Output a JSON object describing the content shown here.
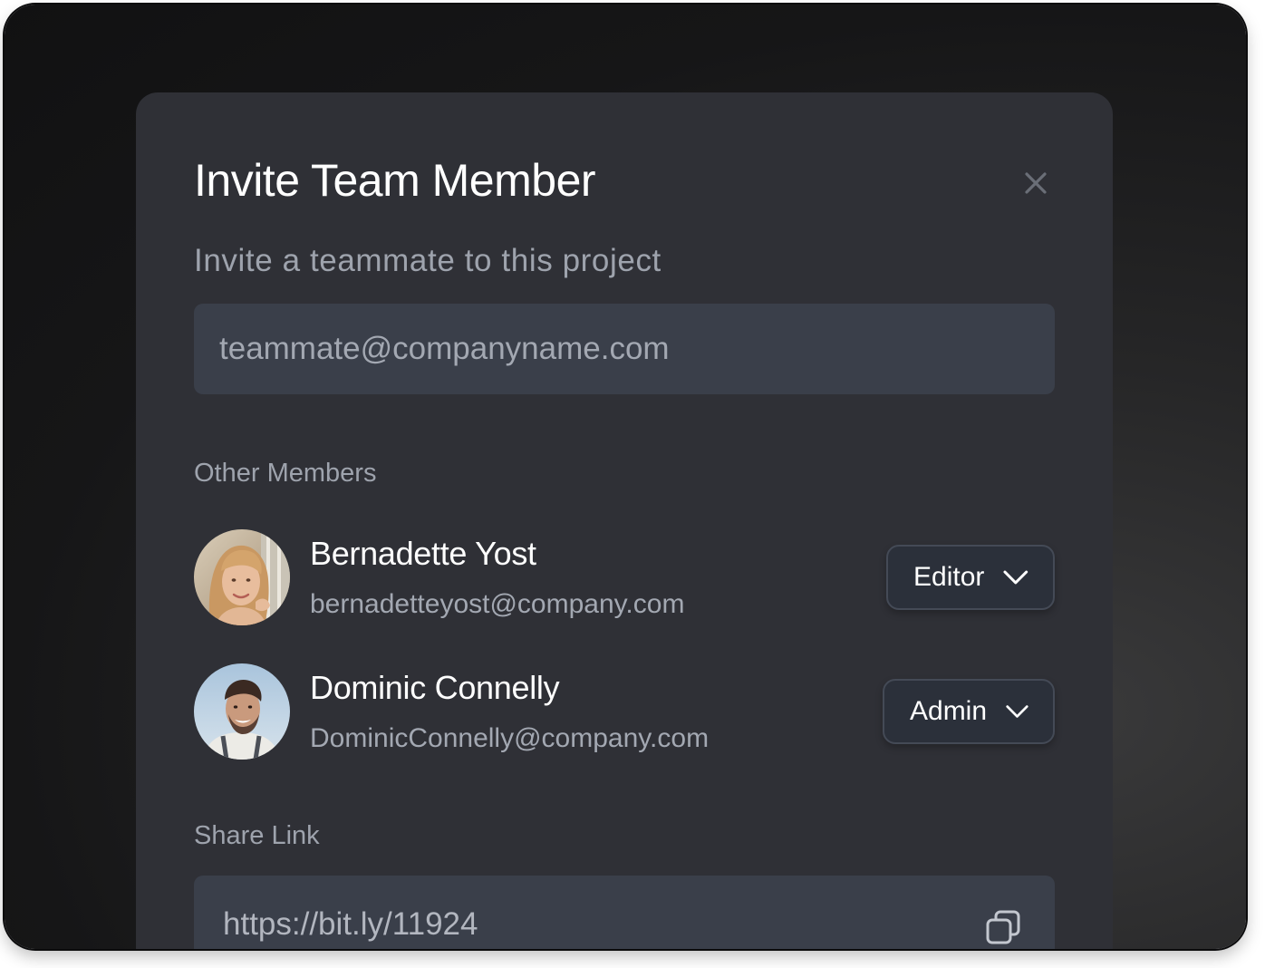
{
  "modal": {
    "title": "Invite Team Member",
    "subtitle": "Invite a teammate to this project",
    "email_placeholder": "teammate@companyname.com",
    "close_icon": "close-icon"
  },
  "members_section": {
    "label": "Other Members",
    "members": [
      {
        "name": "Bernadette Yost",
        "email": "bernadetteyost@company.com",
        "role": "Editor",
        "avatar": "avatar-photo"
      },
      {
        "name": "Dominic Connelly",
        "email": "DominicConnelly@company.com",
        "role": "Admin",
        "avatar": "avatar-photo"
      }
    ]
  },
  "share_section": {
    "label": "Share Link",
    "link": "https://bit.ly/11924",
    "copy_icon": "copy-icon"
  },
  "colors": {
    "modal_bg": "#2f3036",
    "input_bg": "#3a3f4a",
    "text_primary": "#ffffff",
    "text_secondary": "#9ea3ad"
  }
}
